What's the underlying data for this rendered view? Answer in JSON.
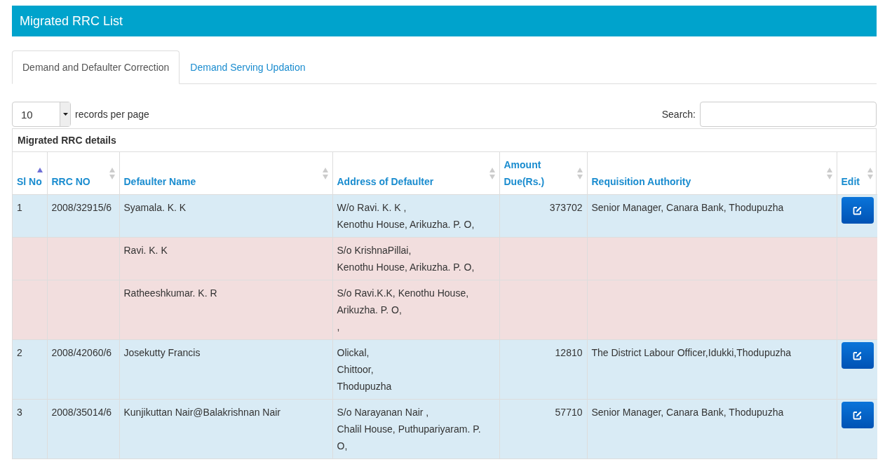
{
  "panel": {
    "title": "Migrated RRC List"
  },
  "tabs": [
    {
      "label": "Demand and Defaulter Correction",
      "selected": true
    },
    {
      "label": "Demand Serving Updation",
      "selected": false
    }
  ],
  "page_size": {
    "value": "10",
    "label": "records per page"
  },
  "search": {
    "label": "Search:"
  },
  "table": {
    "caption": "Migrated RRC details",
    "columns": [
      {
        "label": "Sl No",
        "sorted": true
      },
      {
        "label": "RRC NO",
        "sorted": false
      },
      {
        "label": "Defaulter Name",
        "sorted": false
      },
      {
        "label": "Address of Defaulter",
        "sorted": false
      },
      {
        "label": "Amount Due(Rs.)",
        "sorted": false
      },
      {
        "label": "Requisition Authority",
        "sorted": false
      },
      {
        "label": "Edit",
        "sorted": false
      }
    ],
    "rows": [
      {
        "kind": "main",
        "sl_no": "1",
        "rrc_no": "2008/32915/6",
        "name": "Syamala. K. K",
        "address": [
          "W/o Ravi. K. K ,",
          "Kenothu House, Arikuzha. P. O,"
        ],
        "amount": "373702",
        "authority": "Senior Manager, Canara Bank, Thodupuzha"
      },
      {
        "kind": "sub",
        "name": "Ravi. K. K",
        "address": [
          "S/o KrishnaPillai,",
          "Kenothu House, Arikuzha. P. O,"
        ]
      },
      {
        "kind": "sub",
        "name": "Ratheeshkumar. K. R",
        "address": [
          "S/o Ravi.K.K, Kenothu House,",
          "Arikuzha. P. O,",
          ","
        ]
      },
      {
        "kind": "main",
        "sl_no": "2",
        "rrc_no": "2008/42060/6",
        "name": "Josekutty Francis",
        "address": [
          "Olickal,",
          "Chittoor,",
          "Thodupuzha"
        ],
        "amount": "12810",
        "authority": "The District Labour Officer,Idukki,Thodupuzha"
      },
      {
        "kind": "main",
        "sl_no": "3",
        "rrc_no": "2008/35014/6",
        "name": "Kunjikuttan Nair@Balakrishnan Nair",
        "address": [
          "S/o Narayanan Nair ,",
          "Chalil House, Puthupariyaram. P.",
          "O,"
        ],
        "amount": "57710",
        "authority": "Senior Manager, Canara Bank, Thodupuzha"
      }
    ]
  }
}
